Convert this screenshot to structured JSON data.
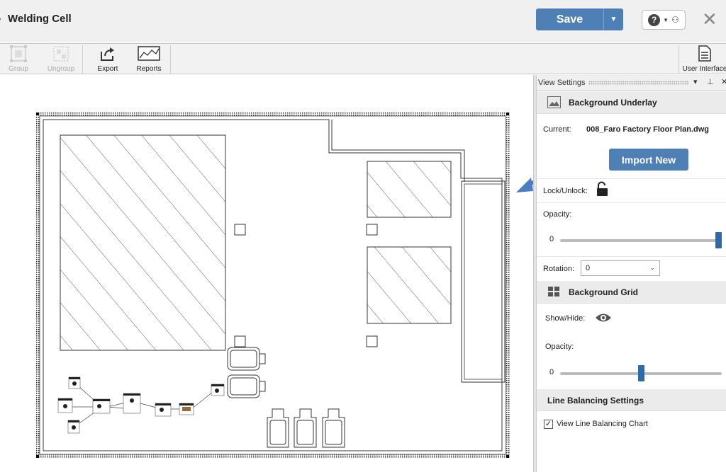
{
  "window": {
    "title": "Welding Cell",
    "close_icon": "close-icon"
  },
  "header": {
    "save_label": "Save",
    "help_icon": "help-icon"
  },
  "toolbar": {
    "group_label": "Group",
    "ungroup_label": "Ungroup",
    "export_label": "Export",
    "reports_label": "Reports",
    "ui_label": "User Interface"
  },
  "panel": {
    "title": "View Settings",
    "underlay": {
      "title": "Background Underlay",
      "current_label": "Current:",
      "current_value": "008_Faro Factory Floor Plan.dwg",
      "import_label": "Import New",
      "lock_label": "Lock/Unlock:",
      "opacity_label": "Opacity:",
      "opacity_min": "0",
      "opacity_level": 1.0,
      "rotation_label": "Rotation:",
      "rotation_value": "0"
    },
    "grid": {
      "title": "Background Grid",
      "show_label": "Show/Hide:",
      "opacity_label": "Opacity:",
      "opacity_min": "0",
      "opacity_level": 0.5
    },
    "line_balancing": {
      "title": "Line Balancing Settings",
      "chart_label": "View Line Balancing Chart",
      "chart_checked": true
    }
  },
  "colors": {
    "accent": "#4e7fb5",
    "arrow": "#4a7dc1"
  }
}
